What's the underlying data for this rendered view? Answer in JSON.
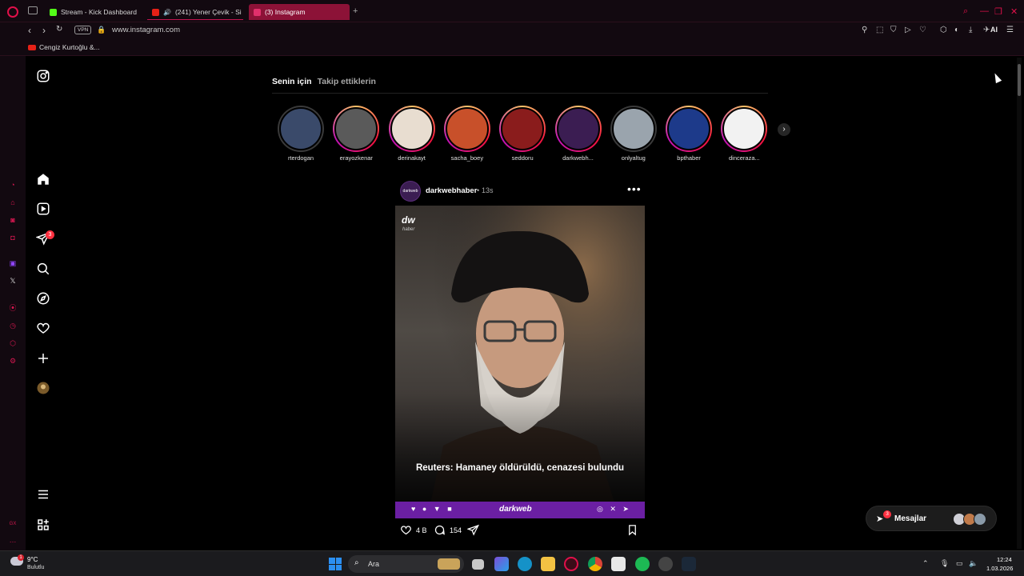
{
  "browser": {
    "tabs": [
      {
        "label": "Stream - Kick Dashboard",
        "favicon_color": "#53fc18"
      },
      {
        "label": "(241) Yener Çevik - Si",
        "favicon_color": "#e62117"
      },
      {
        "label": "(3) Instagram",
        "favicon_color": "#e1306c",
        "active": true
      }
    ],
    "url": "www.instagram.com",
    "vpn_label": "VPN",
    "ai_label": "AI",
    "bookmark": "Cengiz Kurtoğlu &..."
  },
  "ig_nav": {
    "items": [
      "instagram-logo",
      "home",
      "reels",
      "direct",
      "search",
      "explore",
      "notifications",
      "create",
      "profile",
      "more",
      "also-from-meta"
    ],
    "direct_badge": "3"
  },
  "feed": {
    "tabs": [
      "Senin için",
      "Takip ettiklerin"
    ],
    "stories": [
      {
        "name": "rterdogan",
        "seen": true,
        "color": "#3a4a6a"
      },
      {
        "name": "erayozkenar",
        "seen": false,
        "color": "#5a5a5a"
      },
      {
        "name": "derinakayt",
        "seen": false,
        "color": "#e8ddd0"
      },
      {
        "name": "sacha_boey",
        "seen": false,
        "color": "#c8502a"
      },
      {
        "name": "seddoru",
        "seen": false,
        "color": "#8a1c1c"
      },
      {
        "name": "darkwebh...",
        "seen": false,
        "color": "#3b1d52"
      },
      {
        "name": "onlyaltug",
        "seen": true,
        "color": "#9aa4ad"
      },
      {
        "name": "bpthaber",
        "seen": false,
        "color": "#1d3a8a"
      },
      {
        "name": "dinceraza...",
        "seen": false,
        "color": "#f2f2f2"
      }
    ],
    "post": {
      "user": "darkwebhaber",
      "time": "13s",
      "avatar_text": "darkweb",
      "media": {
        "logo": "dw",
        "logo_sub": "haber",
        "headline": "Reuters: Hamaney öldürüldü, cenazesi bulundu",
        "footer_brand": "darkweb"
      },
      "likes": "4 B",
      "comments": "154"
    }
  },
  "messages": {
    "label": "Mesajlar",
    "badge": "3"
  },
  "taskbar": {
    "weather_temp": "9°C",
    "weather_desc": "Bulutlu",
    "weather_badge": "1",
    "search_placeholder": "Ara",
    "time": "12:24",
    "date": "1.03.2026"
  }
}
